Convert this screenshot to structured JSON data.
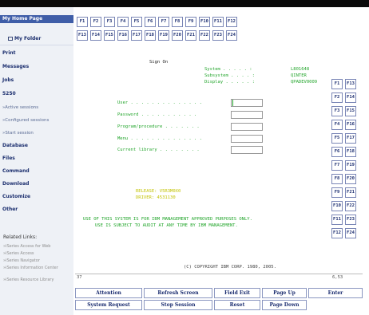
{
  "sidebar": {
    "home": "My Home Page",
    "folder": "My Folder",
    "items": [
      "Print",
      "Messages",
      "Jobs",
      "5250"
    ],
    "sub_items": [
      "»Active sessions",
      "»Configured sessions",
      "»Start session"
    ],
    "items2": [
      "Database",
      "Files",
      "Command",
      "Download",
      "Customize",
      "Other"
    ],
    "related_title": "Related Links:",
    "related_links": [
      "»iSeries Access for Web",
      "»iSeries Access",
      "»iSeries Navigator",
      "»iSeries Information Center",
      "»iSeries Resource Library"
    ]
  },
  "fkeys_top": [
    "F1",
    "F2",
    "F3",
    "F4",
    "F5",
    "F6",
    "F7",
    "F8",
    "F9",
    "F10",
    "F11",
    "F12",
    "F13",
    "F14",
    "F15",
    "F16",
    "F17",
    "F18",
    "F19",
    "F20",
    "F21",
    "F22",
    "F23",
    "F24"
  ],
  "fkeys_side": [
    "F1",
    "F13",
    "F2",
    "F14",
    "F3",
    "F15",
    "F4",
    "F16",
    "F5",
    "F17",
    "F6",
    "F18",
    "F7",
    "F19",
    "F8",
    "F20",
    "F9",
    "F21",
    "F10",
    "F22",
    "F11",
    "F23",
    "F12",
    "F24"
  ],
  "screen": {
    "title": "Sign On",
    "sys_labels": [
      "System . . . . . :",
      "Subsystem . . . . :",
      "Display . . . . . :"
    ],
    "sys_values": [
      "L801648",
      "QINTER",
      "QPADEV0009"
    ],
    "fields": [
      "User . . . . . . . . . . . . . .",
      "Password . . . . . . . . . . .",
      "Program/procedure . . . . . . .",
      "Menu . . . . . . . . . . . . . .",
      "Current library . . . . . . . ."
    ],
    "release": "RELEASE:  V5R3M0X0",
    "driver": "DRIVER:   4531130",
    "notice1": "USE OF THIS SYSTEM IS FOR IBM MANAGEMENT APPROVED PURPOSES     ONLY.",
    "notice2": "USE IS SUBJECT TO AUDIT AT    ANY TIME BY IBM MANAGEMENT.",
    "copyright": "(C) COPYRIGHT IBM CORP. 1980, 2005.",
    "status_left": "37",
    "status_right": "6,53"
  },
  "buttons": {
    "attention": "Attention",
    "refresh": "Refresh Screen",
    "field_exit": "Field Exit",
    "page_up": "Page Up",
    "enter": "Enter",
    "system_request": "System Request",
    "stop_session": "Stop Session",
    "reset": "Reset",
    "page_down": "Page Down"
  },
  "colors": {
    "brand": "#3f5ea8",
    "terminal_green": "#22a52b",
    "terminal_yellow": "#c2c200",
    "link": "#1a2c6f"
  }
}
